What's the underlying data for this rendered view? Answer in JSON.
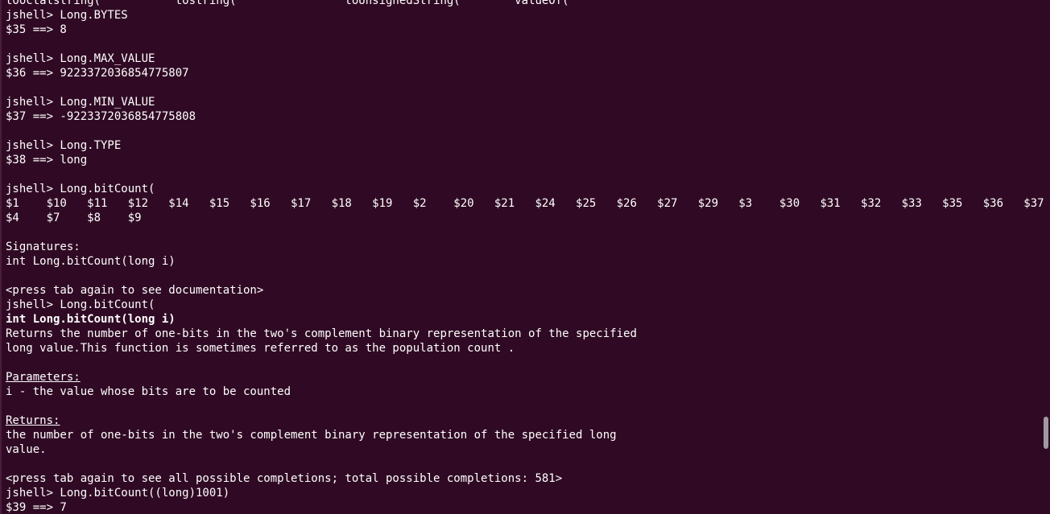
{
  "terminal": {
    "lines": [
      "tooctalstring(           tostring(                toUnsignedString(        valueOf(",
      "jshell> Long.BYTES",
      "$35 ==> 8",
      "",
      "jshell> Long.MAX_VALUE",
      "$36 ==> 9223372036854775807",
      "",
      "jshell> Long.MIN_VALUE",
      "$37 ==> -9223372036854775808",
      "",
      "jshell> Long.TYPE",
      "$38 ==> long",
      "",
      "jshell> Long.bitCount(",
      "$1    $10   $11   $12   $14   $15   $16   $17   $18   $19   $2    $20   $21   $24   $25   $26   $27   $29   $3    $30   $31   $32   $33   $35   $36   $37",
      "$4    $7    $8    $9",
      "",
      "Signatures:",
      "int Long.bitCount(long i)",
      "",
      "<press tab again to see documentation>",
      "jshell> Long.bitCount(",
      "int Long.bitCount(long i)",
      "Returns the number of one-bits in the two's complement binary representation of the specified",
      "long value.This function is sometimes referred to as the population count .",
      "",
      "Parameters:",
      "i - the value whose bits are to be counted",
      "",
      "Returns:",
      "the number of one-bits in the two's complement binary representation of the specified long",
      "value.",
      "",
      "<press tab again to see all possible completions; total possible completions: 581>",
      "jshell> Long.bitCount((long)1001)",
      "$39 ==> 7"
    ]
  },
  "colors": {
    "background": "#300a24",
    "foreground": "#ffffff",
    "scrollbar_thumb": "#a09aa0"
  }
}
